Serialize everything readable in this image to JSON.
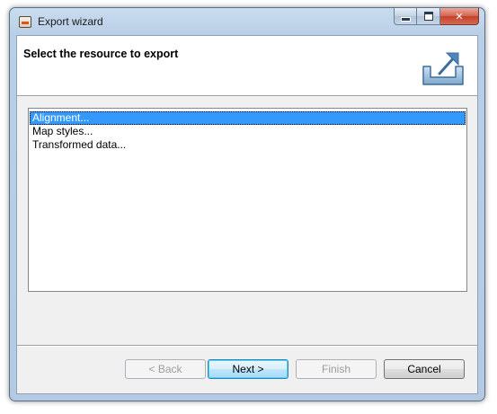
{
  "window": {
    "title": "Export wizard"
  },
  "banner": {
    "title": "Select the resource to export",
    "icon": "export-icon"
  },
  "resources": {
    "items": [
      {
        "label": "Alignment...",
        "selected": true
      },
      {
        "label": "Map styles...",
        "selected": false
      },
      {
        "label": "Transformed data...",
        "selected": false
      }
    ]
  },
  "buttons": {
    "back": {
      "label": "< Back",
      "enabled": false
    },
    "next": {
      "label": "Next >",
      "enabled": true,
      "default": true
    },
    "finish": {
      "label": "Finish",
      "enabled": false
    },
    "cancel": {
      "label": "Cancel",
      "enabled": true
    }
  },
  "colors": {
    "selection": "#3399ff",
    "title_bar": "#b9cfe7",
    "close_button": "#c4402a"
  }
}
